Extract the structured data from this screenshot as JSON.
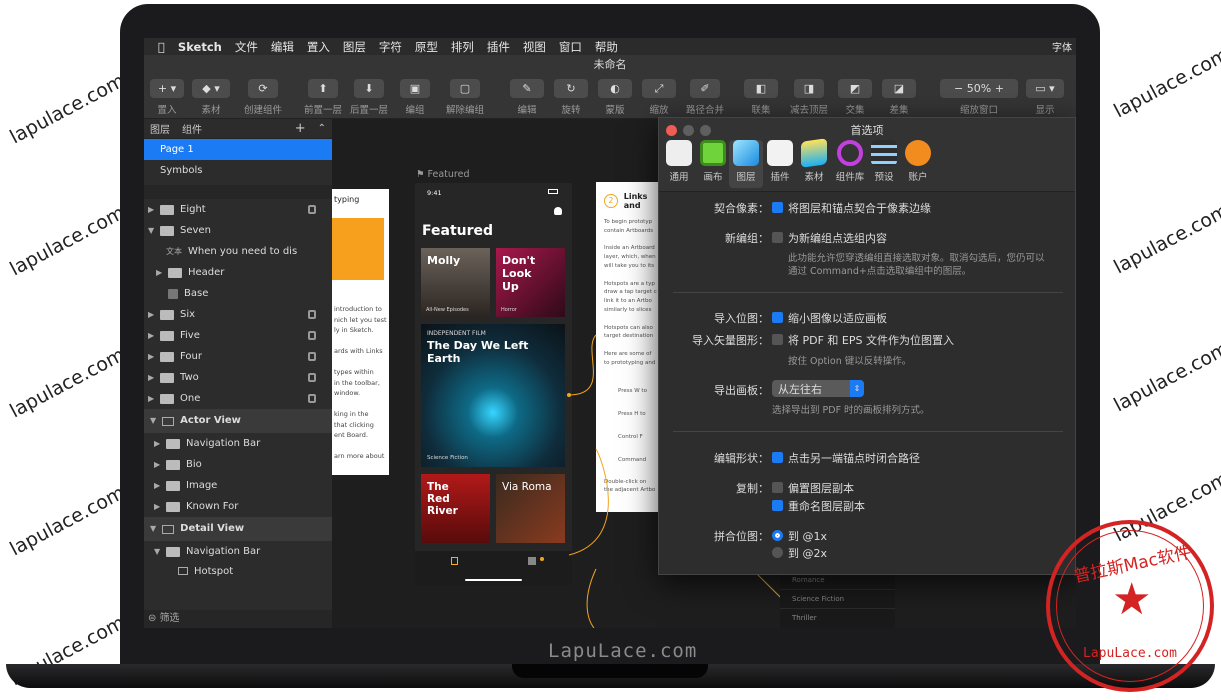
{
  "watermarks": [
    "lapulace.com",
    "lapulace.com",
    "lapulace.com",
    "lapulace.com",
    "lapulace.com",
    "lapulace.com",
    "lapulace.com",
    "lapulace.com",
    "lapulace.com"
  ],
  "brand": "LapuLace.com",
  "menubar": {
    "app": "Sketch",
    "items": [
      "文件",
      "编辑",
      "置入",
      "图层",
      "字符",
      "原型",
      "排列",
      "插件",
      "视图",
      "窗口",
      "帮助"
    ],
    "right": "字体"
  },
  "window_title": "未命名",
  "toolbar": {
    "insert": "置入",
    "material": "素材",
    "create_component": "创建组件",
    "bring_forward": "前置一层",
    "send_backward": "后置一层",
    "group": "编组",
    "ungroup": "解除编组",
    "edit": "编辑",
    "rotate": "旋转",
    "mask": "蒙版",
    "scale": "缩放",
    "flatten": "路径合并",
    "union": "联集",
    "subtract": "减去顶层",
    "intersect": "交集",
    "difference": "差集",
    "zoom_value": "50%",
    "zoom_label": "缩放窗口",
    "display": "显示"
  },
  "sidebar": {
    "tab_layers": "图层",
    "tab_components": "组件",
    "pages": [
      "Page 1",
      "Symbols"
    ],
    "layers": [
      {
        "name": "Eight",
        "lock": true
      },
      {
        "name": "Seven",
        "lock": false
      },
      {
        "name": "When you need to dis",
        "prefix": "文本",
        "lock": false
      },
      {
        "name": "Header",
        "lock": false
      },
      {
        "name": "Base",
        "lock": false
      },
      {
        "name": "Six",
        "lock": true
      },
      {
        "name": "Five",
        "lock": true
      },
      {
        "name": "Four",
        "lock": true
      },
      {
        "name": "Two",
        "lock": true
      },
      {
        "name": "One",
        "lock": true
      }
    ],
    "actor_view": "Actor View",
    "actor_children": [
      "Navigation Bar",
      "Bio",
      "Image",
      "Known For"
    ],
    "detail_view": "Detail View",
    "detail_children": [
      "Navigation Bar",
      "Hotspot"
    ],
    "filter": "筛选"
  },
  "canvas": {
    "artboard_label": "Featured",
    "status_time": "9:41",
    "featured_title": "Featured",
    "cards": [
      {
        "title": "Molly",
        "sub": "All-New Episodes"
      },
      {
        "title": "Don't Look Up",
        "sub": "Horror"
      }
    ],
    "hero_kicker": "INDEPENDENT FILM",
    "hero_title": "The Day We Left Earth",
    "hero_sub": "Science Fiction",
    "bottom_cards": [
      {
        "title": "The Red River"
      },
      {
        "title": "Via Roma"
      }
    ],
    "left_art_title": "typing",
    "left_art_text": [
      "introduction to",
      "nich let you test",
      "ly in Sketch.",
      "",
      "ards with Links",
      "",
      "types within",
      "in the toolbar,",
      "window.",
      "",
      "king in the",
      "that clicking",
      "ent Board.",
      "",
      "arn more about"
    ],
    "right_art_title": "Links and",
    "right_art_lines": [
      "To begin prototyp",
      "contain Artboards",
      "",
      "Inside an Artboard",
      "layer, which, when",
      "will take you to its",
      "",
      "Hotspots are a typ",
      "draw a tap target c",
      "link it to an Artbo",
      "similarly to slices",
      "",
      "Hotspots can also",
      "target destination",
      "",
      "Here are some of",
      "to prototyping and"
    ],
    "shortcuts": [
      "Press W to",
      "Press H to",
      "Control F",
      "Command"
    ],
    "right_bottom": [
      "Double-click on",
      "the adjacent Artbo"
    ],
    "genres": [
      "Romance",
      "Science Fiction",
      "Thriller"
    ]
  },
  "prefs": {
    "title": "首选项",
    "tabs": [
      "通用",
      "画布",
      "图层",
      "插件",
      "素材",
      "组件库",
      "预设",
      "账户"
    ],
    "snap_label": "契合像素：",
    "snap_text": "将图层和锚点契合于像素边缘",
    "newgroup_label": "新编组：",
    "newgroup_text": "为新编组点选组内容",
    "newgroup_hint1": "此功能允许您穿透编组直接选取对象。取消勾选后，您仍可以",
    "newgroup_hint2": "通过 Command+点击选取编组中的图层。",
    "import_bitmap_label": "导入位图：",
    "import_bitmap_text": "缩小图像以适应画板",
    "import_vector_label": "导入矢量图形：",
    "import_vector_text": "将 PDF 和 EPS 文件作为位图置入",
    "import_vector_hint": "按住 Option 键以反转操作。",
    "export_label": "导出画板：",
    "export_value": "从左往右",
    "export_hint": "选择导出到 PDF 时的画板排列方式。",
    "edit_shape_label": "编辑形状：",
    "edit_shape_text": "点击另一端锚点时闭合路径",
    "dup_label": "复制：",
    "dup_offset": "偏置图层副本",
    "dup_rename": "重命名图层副本",
    "flatten_label": "拼合位图：",
    "flatten_1x": "到 @1x",
    "flatten_2x": "到 @2x"
  },
  "stamp": {
    "top": "普拉斯Mac软件",
    "bottom": "LapuLace.com"
  }
}
